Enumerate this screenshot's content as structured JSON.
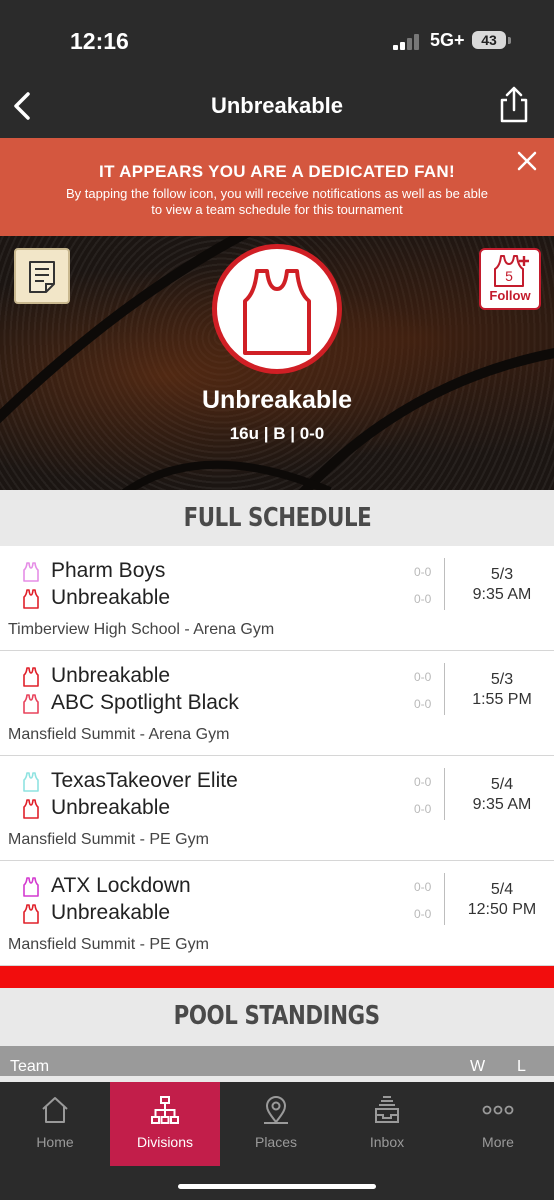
{
  "status_bar": {
    "time": "12:16",
    "network": "5G+",
    "battery": "43"
  },
  "header": {
    "title": "Unbreakable"
  },
  "banner": {
    "title": "IT APPEARS YOU ARE A DEDICATED FAN!",
    "message": "By tapping the follow icon, you will receive notifications as well as be able to view a team schedule for this tournament"
  },
  "team": {
    "name": "Unbreakable",
    "meta": "16u | B | 0-0",
    "follow_label": "Follow",
    "follow_badge": "5",
    "logo_color": "#d01f25"
  },
  "sections": {
    "schedule": "FULL SCHEDULE",
    "standings": "POOL STANDINGS"
  },
  "games": [
    {
      "teams": [
        {
          "name": "Pharm Boys",
          "color": "#e58de6",
          "score": "0-0"
        },
        {
          "name": "Unbreakable",
          "color": "#e0202a",
          "score": "0-0"
        }
      ],
      "date": "5/3",
      "time": "9:35 AM",
      "venue": "Timberview High School - Arena Gym"
    },
    {
      "teams": [
        {
          "name": "Unbreakable",
          "color": "#e0202a",
          "score": "0-0"
        },
        {
          "name": "ABC Spotlight Black",
          "color": "#e8435c",
          "score": "0-0"
        }
      ],
      "date": "5/3",
      "time": "1:55 PM",
      "venue": "Mansfield Summit - Arena Gym"
    },
    {
      "teams": [
        {
          "name": "TexasTakeover Elite",
          "color": "#8fe3e1",
          "score": "0-0"
        },
        {
          "name": "Unbreakable",
          "color": "#e0202a",
          "score": "0-0"
        }
      ],
      "date": "5/4",
      "time": "9:35 AM",
      "venue": "Mansfield Summit - PE Gym"
    },
    {
      "teams": [
        {
          "name": "ATX Lockdown",
          "color": "#d43ad0",
          "score": "0-0"
        },
        {
          "name": "Unbreakable",
          "color": "#e0202a",
          "score": "0-0"
        }
      ],
      "date": "5/4",
      "time": "12:50 PM",
      "venue": "Mansfield Summit - PE Gym"
    }
  ],
  "standings": {
    "columns": {
      "team": "Team",
      "wins": "W",
      "losses": "L"
    }
  },
  "tabs": [
    {
      "label": "Home",
      "icon": "home-icon",
      "active": false
    },
    {
      "label": "Divisions",
      "icon": "bracket-icon",
      "active": true
    },
    {
      "label": "Places",
      "icon": "map-pin-icon",
      "active": false
    },
    {
      "label": "Inbox",
      "icon": "inbox-icon",
      "active": false
    },
    {
      "label": "More",
      "icon": "more-icon",
      "active": false
    }
  ],
  "colors": {
    "accent": "#c21e4a",
    "banner": "#d4573f",
    "alert_bar": "#f20d0d"
  }
}
